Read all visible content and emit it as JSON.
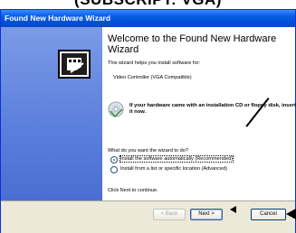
{
  "caption": "(SUBSCRIPT: VGA)",
  "window": {
    "title": "Found New Hardware Wizard"
  },
  "content": {
    "welcome_title": "Welcome to the Found New Hardware Wizard",
    "intro": "This wizard helps you install software for:",
    "device": "Video Controller (VGA Compatible)",
    "cd_prompt": "If your hardware came with an installation CD or floppy disk, insert it now.",
    "question": "What do you want the wizard to do?",
    "options": [
      {
        "label": "Install the software automatically (Recommended)",
        "selected": true
      },
      {
        "label": "Install from a list or specific location (Advanced)",
        "selected": false
      }
    ],
    "click_next": "Click Next to continue."
  },
  "buttons": {
    "back": "< Back",
    "next": "Next >",
    "cancel": "Cancel"
  },
  "colors": {
    "titlebar": "#0a5fe6",
    "left_panel": "#5a7edc",
    "radio_dot": "#21a121"
  },
  "icons": {
    "wizard": "hardware-wizard-icon",
    "cd": "cd-disk-icon"
  }
}
